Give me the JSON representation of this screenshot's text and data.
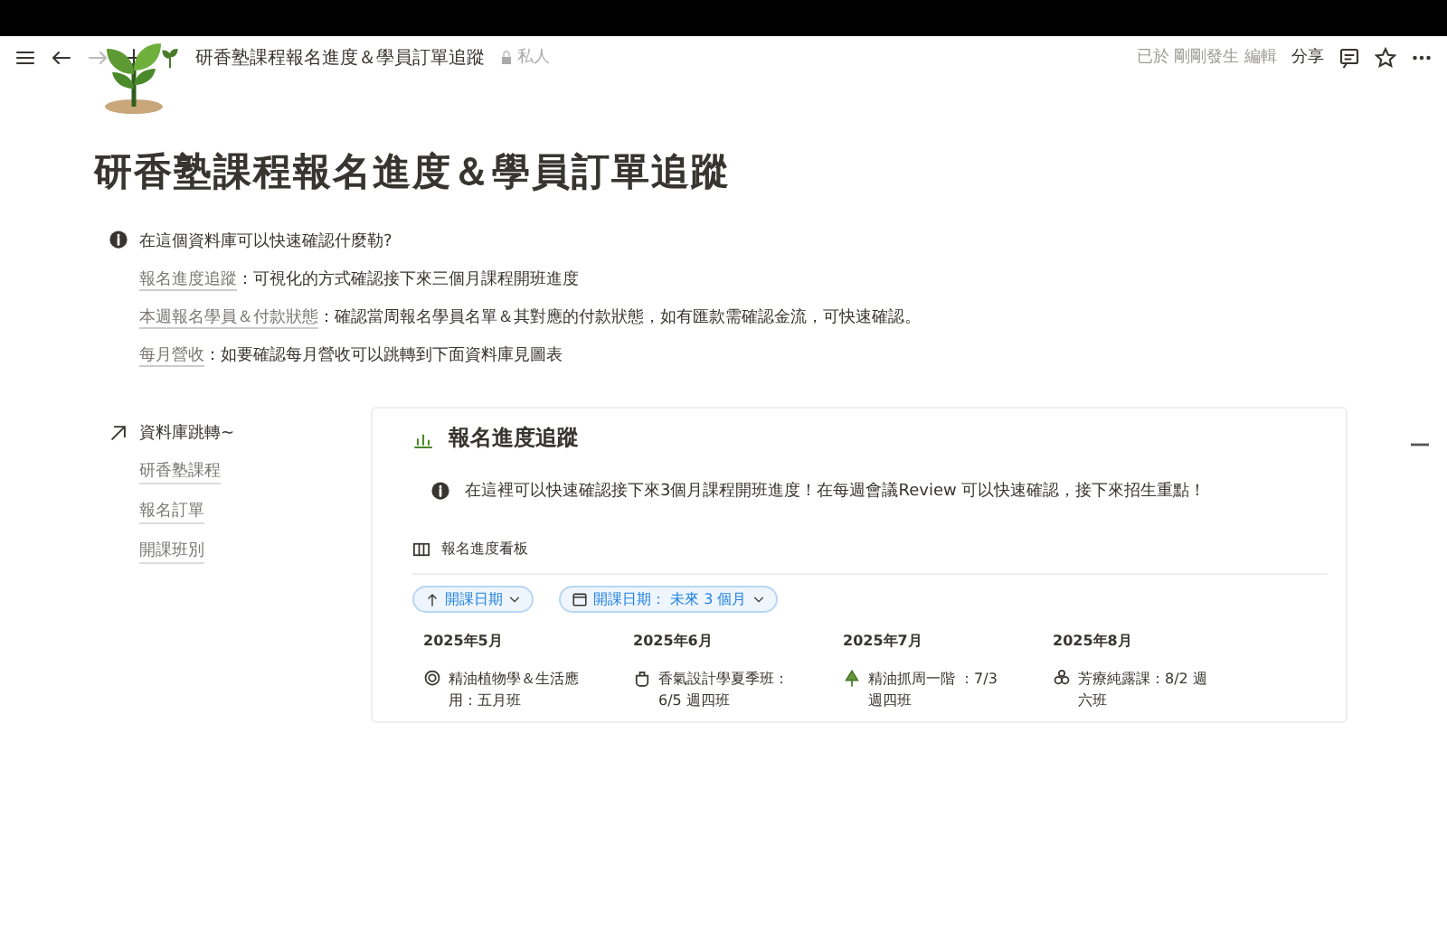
{
  "topbar": {
    "title": "研香塾課程報名進度＆學員訂單追蹤",
    "privacy": "私人",
    "edited": "已於 剛剛發生 編輯",
    "share": "分享"
  },
  "page": {
    "title": "研香塾課程報名進度＆學員訂單追蹤",
    "callout": {
      "heading": "在這個資料庫可以快速確認什麼勒?",
      "lines": [
        {
          "link": "報名進度追蹤",
          "text": "：可視化的方式確認接下來三個月課程開班進度"
        },
        {
          "link": "本週報名學員＆付款狀態",
          "text": "：確認當周報名學員名單＆其對應的付款狀態，如有匯款需確認金流，可快速確認。"
        },
        {
          "link": "每月營收",
          "text": "：如要確認每月營收可以跳轉到下面資料庫見圖表"
        }
      ]
    }
  },
  "sidebar": {
    "heading": "資料庫跳轉~",
    "links": [
      "研香塾課程",
      "報名訂單",
      "開課班別"
    ]
  },
  "database": {
    "title": "報名進度追蹤",
    "callout": "在這裡可以快速確認接下來3個月課程開班進度！在每週會議Review 可以快速確認，接下來招生重點！",
    "view": "報名進度看板",
    "filters": [
      {
        "kind": "sort",
        "label": "開課日期"
      },
      {
        "kind": "date",
        "label": "開課日期： 未來 3 個月"
      }
    ],
    "columns": [
      {
        "heading": "2025年5月",
        "cards": [
          {
            "title": "精油植物學＆生活應用：五月班"
          }
        ]
      },
      {
        "heading": "2025年6月",
        "cards": [
          {
            "title": "香氣設計學夏季班：6/5 週四班"
          }
        ]
      },
      {
        "heading": "2025年7月",
        "cards": [
          {
            "title": "精油抓周一階 ：7/3 週四班"
          }
        ]
      },
      {
        "heading": "2025年8月",
        "cards": [
          {
            "title": "芳療純露課：8/2 週六班"
          }
        ]
      }
    ]
  }
}
